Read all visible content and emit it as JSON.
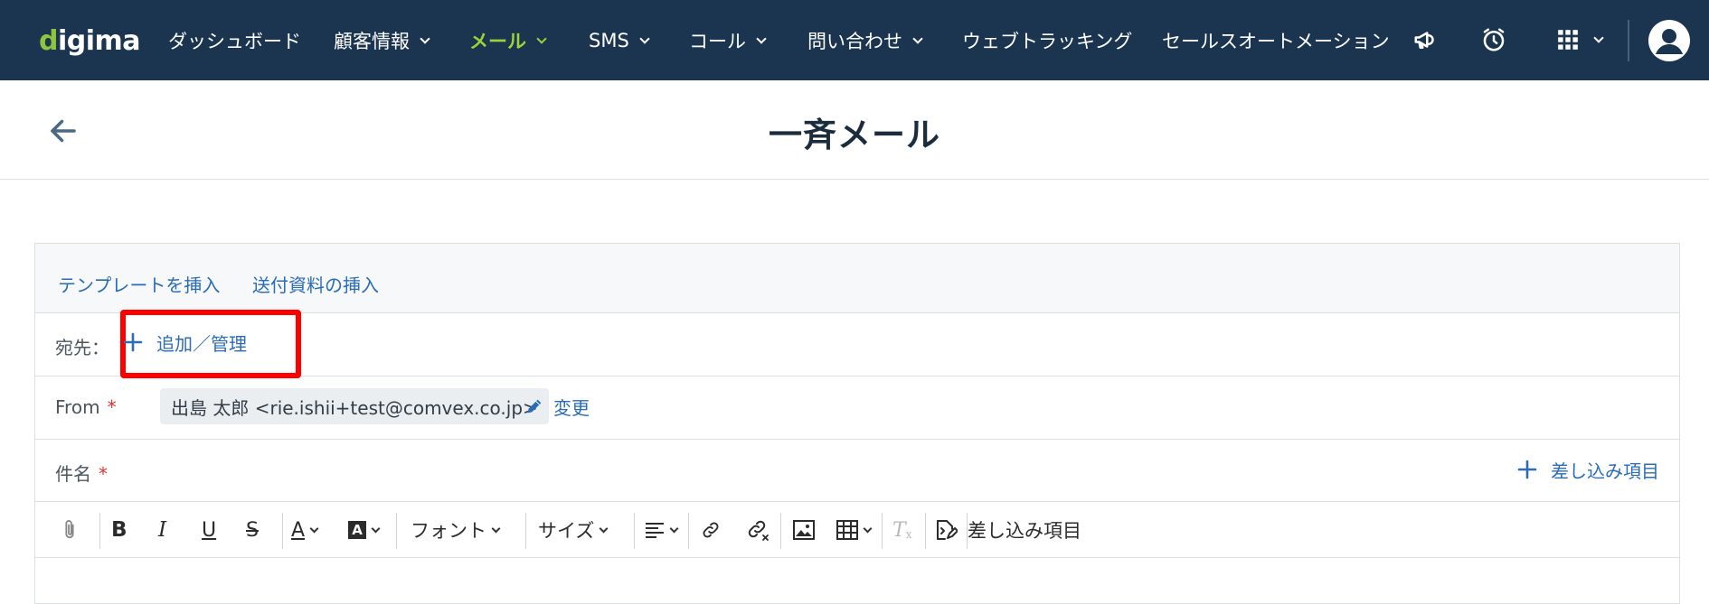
{
  "app": {
    "logo_text": "digima",
    "logo_accent": "d",
    "brand_color": "#1b3550",
    "accent_color": "#9bd33a"
  },
  "nav": {
    "items": [
      {
        "label": "ダッシュボード",
        "dropdown": false
      },
      {
        "label": "顧客情報",
        "dropdown": true
      },
      {
        "label": "メール",
        "dropdown": true,
        "active": true
      },
      {
        "label": "SMS",
        "dropdown": true
      },
      {
        "label": "コール",
        "dropdown": true
      },
      {
        "label": "問い合わせ",
        "dropdown": true
      },
      {
        "label": "ウェブトラッキング",
        "dropdown": false
      },
      {
        "label": "セールスオートメーション",
        "dropdown": false
      }
    ],
    "icons": [
      "megaphone-icon",
      "alarm-clock-icon",
      "apps-grid-icon",
      "user-avatar-icon"
    ]
  },
  "page": {
    "title": "一斉メール"
  },
  "form": {
    "tabs": [
      "テンプレートを挿入",
      "送付資料の挿入"
    ],
    "to_label": "宛先：",
    "add_manage_label": "追加／管理",
    "from_label": "From",
    "required_mark": "*",
    "from_value": "出島 太郎 <rie.ishii+test@comvex.co.jp>",
    "change_label": "変更",
    "subject_label": "件名",
    "merge_field_label": "差し込み項目"
  },
  "toolbar": {
    "font_label": "フォント",
    "size_label": "サイズ",
    "merge_label": "差し込み項目",
    "icons": [
      "attachment-icon",
      "bold-icon",
      "italic-icon",
      "underline-icon",
      "strikethrough-icon",
      "font-color-icon",
      "background-color-icon",
      "align-icon",
      "link-icon",
      "unlink-icon",
      "image-icon",
      "table-icon",
      "clear-format-icon",
      "merge-field-icon"
    ]
  }
}
